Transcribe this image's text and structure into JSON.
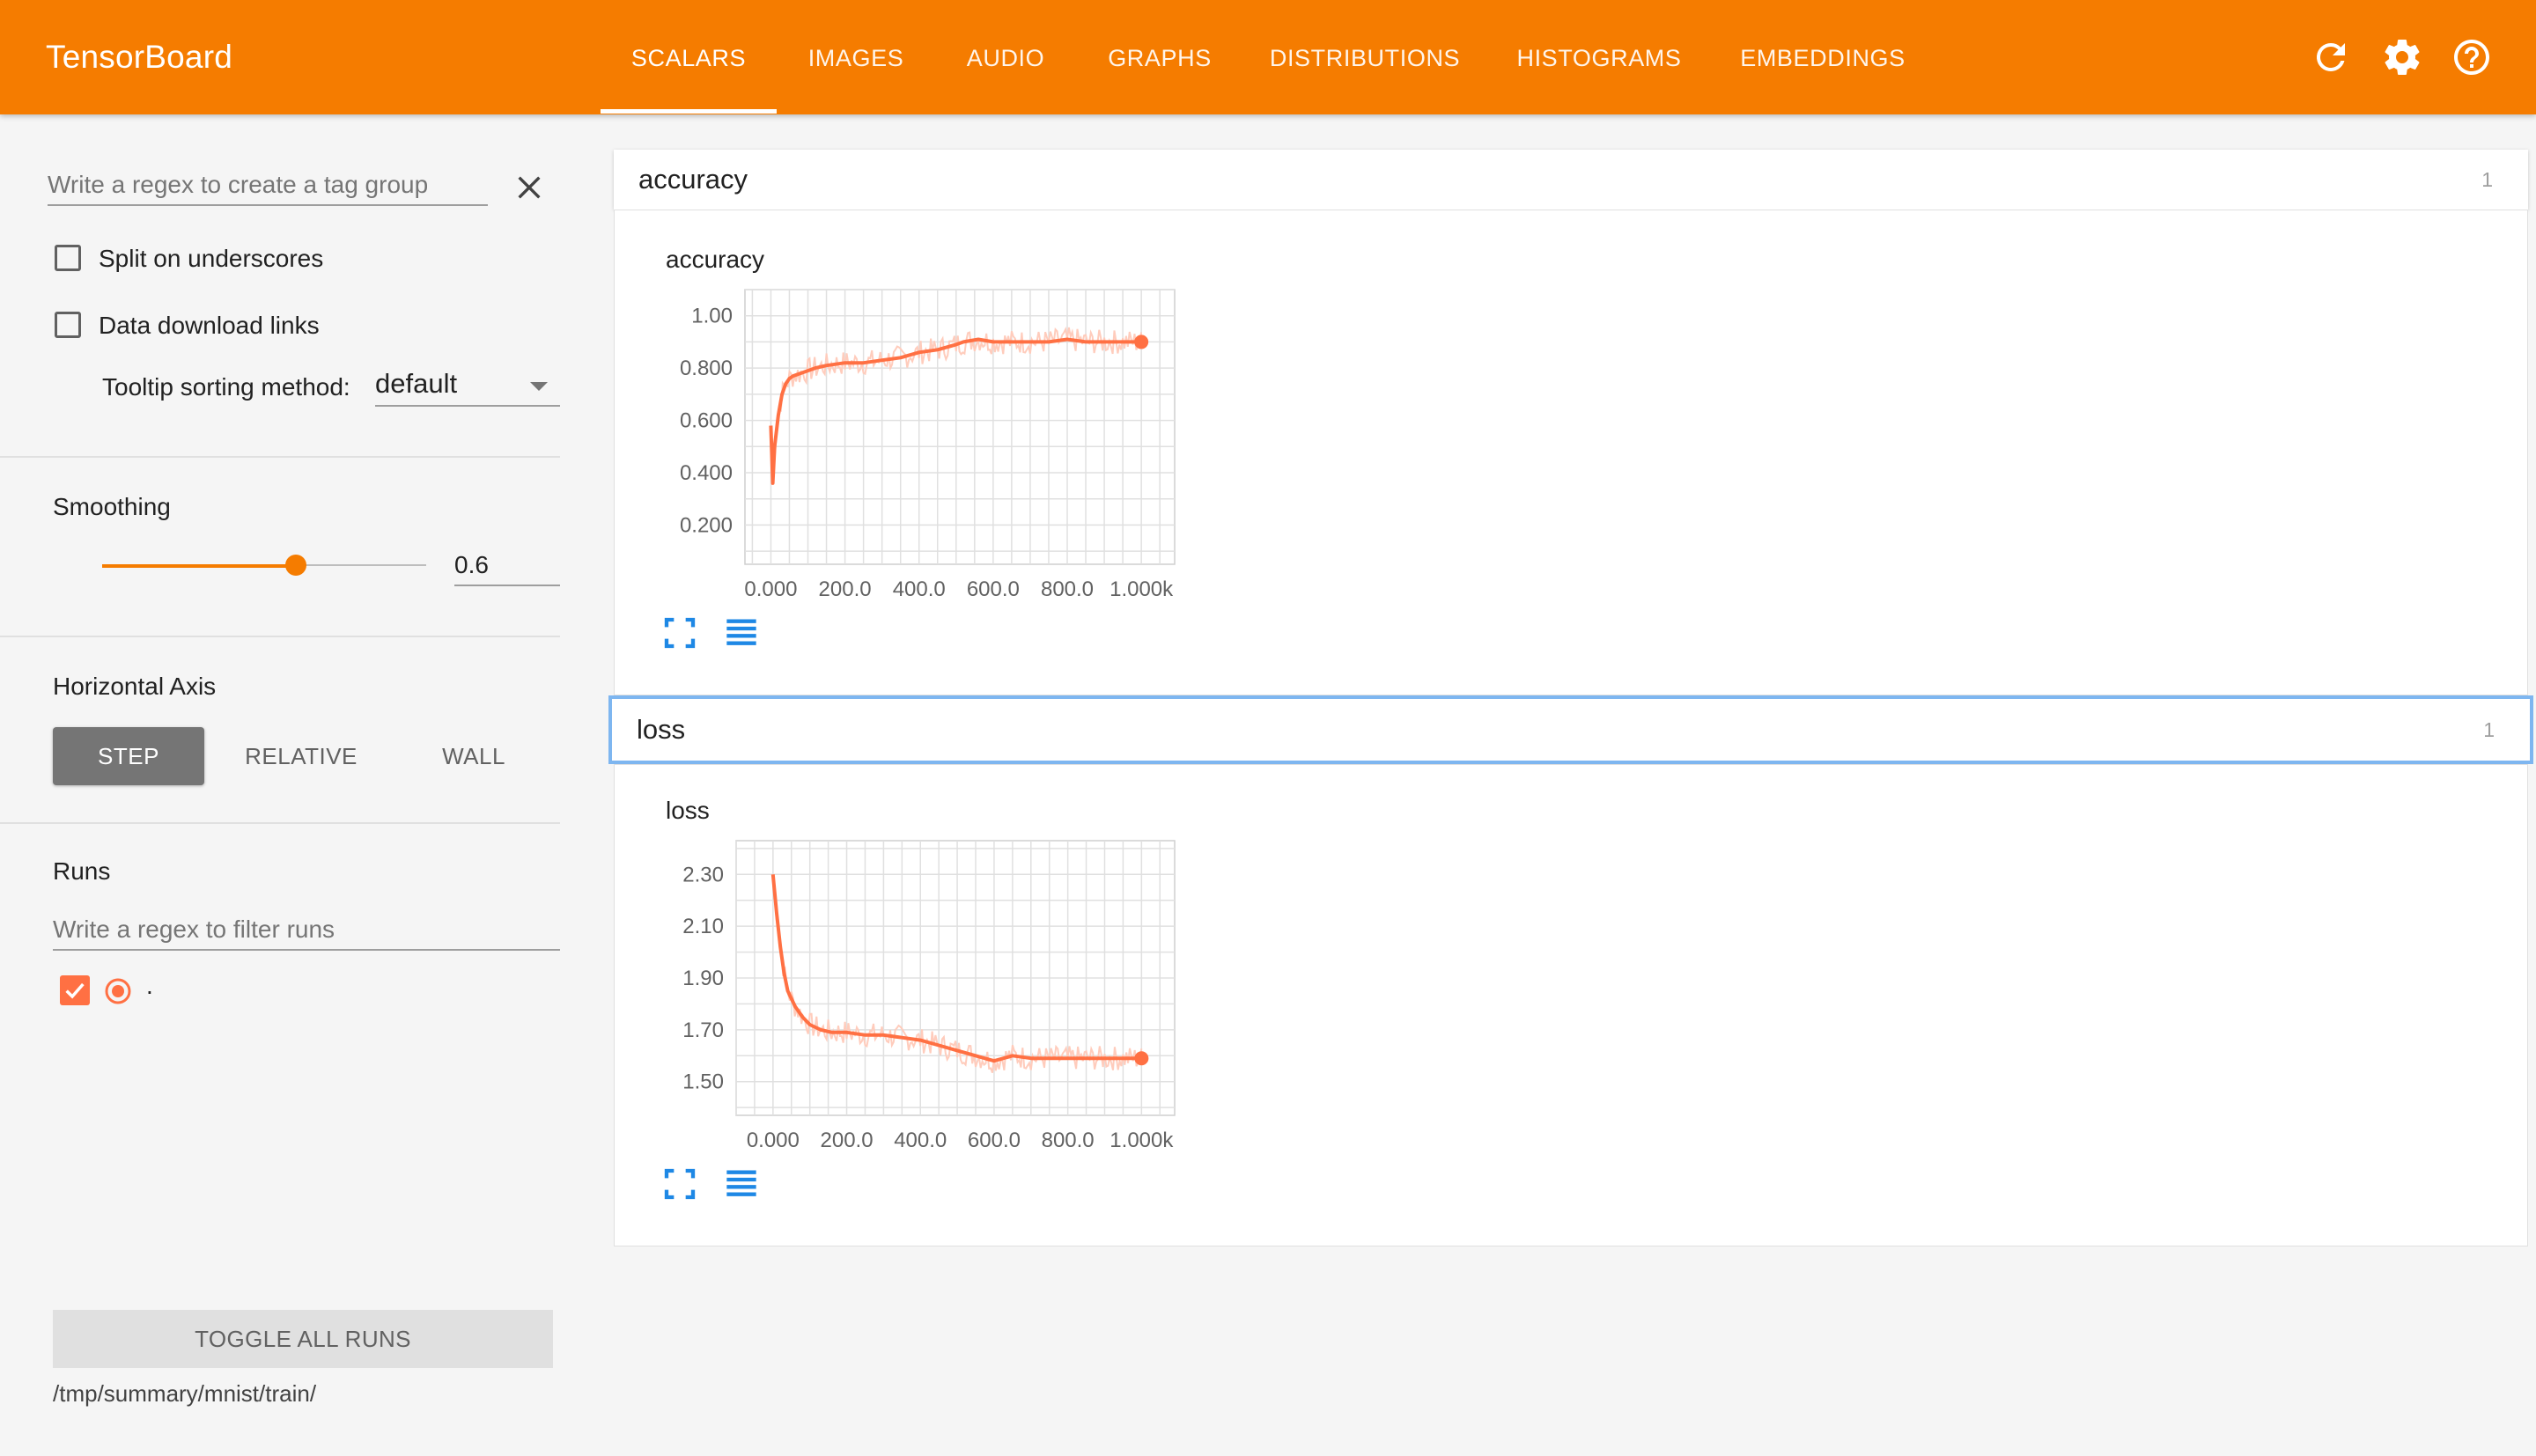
{
  "app": {
    "title": "TensorBoard"
  },
  "nav": {
    "tabs": [
      {
        "label": "SCALARS"
      },
      {
        "label": "IMAGES"
      },
      {
        "label": "AUDIO"
      },
      {
        "label": "GRAPHS"
      },
      {
        "label": "DISTRIBUTIONS"
      },
      {
        "label": "HISTOGRAMS"
      },
      {
        "label": "EMBEDDINGS"
      }
    ],
    "active_tab": "SCALARS",
    "icons": [
      "refresh-icon",
      "settings-icon",
      "help-icon"
    ]
  },
  "sidebar": {
    "tag_regex_placeholder": "Write a regex to create a tag group",
    "split_underscores_label": "Split on underscores",
    "split_underscores_checked": false,
    "download_links_label": "Data download links",
    "download_links_checked": false,
    "tooltip_sort_label": "Tooltip sorting method:",
    "tooltip_sort_value": "default",
    "smoothing_label": "Smoothing",
    "smoothing_value": "0.6",
    "smoothing_fraction": 0.6,
    "horizontal_axis_label": "Horizontal Axis",
    "axis_options": [
      {
        "label": "STEP"
      },
      {
        "label": "RELATIVE"
      },
      {
        "label": "WALL"
      }
    ],
    "axis_selected": "STEP",
    "runs_label": "Runs",
    "runs_filter_placeholder": "Write a regex to filter runs",
    "runs": [
      {
        "name": ".",
        "checked": true,
        "color": "#ff7043"
      }
    ],
    "toggle_all_label": "TOGGLE ALL RUNS",
    "logdir": "/tmp/summary/mnist/train/"
  },
  "categories": [
    {
      "name": "accuracy",
      "count": "1"
    },
    {
      "name": "loss",
      "count": "1"
    }
  ],
  "colors": {
    "accent": "#f57c00",
    "series": "#ff7043",
    "series_raw": "#ffccbc",
    "icon_blue": "#1e88e5"
  },
  "chart_data": [
    {
      "type": "line",
      "title": "accuracy",
      "xlabel": "",
      "ylabel": "",
      "x_ticks": [
        "0.000",
        "200.0",
        "400.0",
        "600.0",
        "800.0",
        "1.000k"
      ],
      "y_ticks": [
        "0.200",
        "0.400",
        "0.600",
        "0.800",
        "1.00"
      ],
      "xlim": [
        -70,
        1090
      ],
      "ylim": [
        0.05,
        1.1
      ],
      "grid": true,
      "series": [
        {
          "name": ".",
          "x": [
            0,
            5,
            10,
            20,
            30,
            40,
            50,
            60,
            80,
            100,
            120,
            150,
            200,
            250,
            300,
            350,
            400,
            450,
            500,
            520,
            560,
            600,
            650,
            700,
            750,
            800,
            850,
            900,
            950,
            1000
          ],
          "y": [
            0.58,
            0.36,
            0.5,
            0.62,
            0.7,
            0.74,
            0.76,
            0.77,
            0.78,
            0.79,
            0.8,
            0.81,
            0.82,
            0.82,
            0.83,
            0.84,
            0.86,
            0.87,
            0.89,
            0.9,
            0.91,
            0.9,
            0.9,
            0.9,
            0.9,
            0.91,
            0.9,
            0.9,
            0.9,
            0.9
          ]
        }
      ]
    },
    {
      "type": "line",
      "title": "loss",
      "xlabel": "",
      "ylabel": "",
      "x_ticks": [
        "0.000",
        "200.0",
        "400.0",
        "600.0",
        "800.0",
        "1.000k"
      ],
      "y_ticks": [
        "1.50",
        "1.70",
        "1.90",
        "2.10",
        "2.30"
      ],
      "xlim": [
        -100,
        1090
      ],
      "ylim": [
        1.37,
        2.43
      ],
      "grid": true,
      "series": [
        {
          "name": ".",
          "x": [
            0,
            10,
            20,
            30,
            40,
            60,
            80,
            100,
            130,
            160,
            200,
            250,
            300,
            350,
            400,
            450,
            500,
            550,
            600,
            650,
            700,
            750,
            800,
            850,
            900,
            950,
            1000
          ],
          "y": [
            2.3,
            2.15,
            2.02,
            1.92,
            1.85,
            1.79,
            1.75,
            1.72,
            1.7,
            1.69,
            1.69,
            1.68,
            1.68,
            1.67,
            1.66,
            1.64,
            1.62,
            1.6,
            1.58,
            1.6,
            1.59,
            1.59,
            1.59,
            1.59,
            1.59,
            1.59,
            1.59
          ]
        }
      ]
    }
  ]
}
